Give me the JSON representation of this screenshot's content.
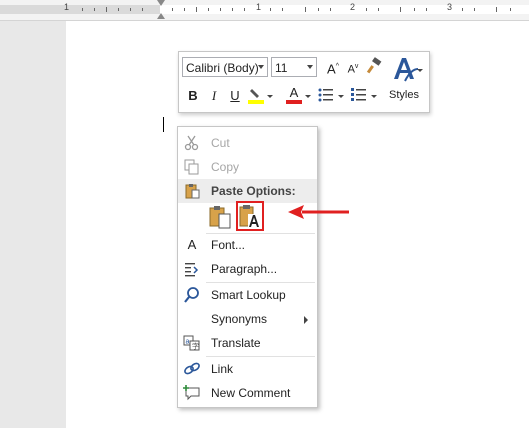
{
  "ruler": {
    "labels": [
      "1",
      "1",
      "2",
      "3"
    ]
  },
  "minibar": {
    "font_name": "Calibri (Body)",
    "font_size": "11",
    "styles_label": "Styles",
    "buttons": [
      "grow-font",
      "shrink-font",
      "format-painter",
      "bold",
      "italic",
      "underline",
      "highlight",
      "font-color",
      "bullets",
      "numbering",
      "styles"
    ],
    "bold": "B",
    "italic": "I",
    "underline": "U",
    "font_color_letter": "A",
    "grow": "A",
    "shrink": "A",
    "colors": {
      "highlight": "#ffff00",
      "font_color": "#e0201f",
      "styles_icon": "#2b579a"
    }
  },
  "context_menu": {
    "cut": "Cut",
    "copy": "Copy",
    "paste_options": "Paste Options:",
    "font": "Font...",
    "paragraph": "Paragraph...",
    "smart_lookup": "Smart Lookup",
    "synonyms": "Synonyms",
    "translate": "Translate",
    "link": "Link",
    "new_comment": "New Comment",
    "paste_buttons": [
      "keep-source-formatting",
      "keep-text-only"
    ],
    "selected_paste": "keep-text-only"
  },
  "annotation": {
    "color": "#e02020"
  }
}
